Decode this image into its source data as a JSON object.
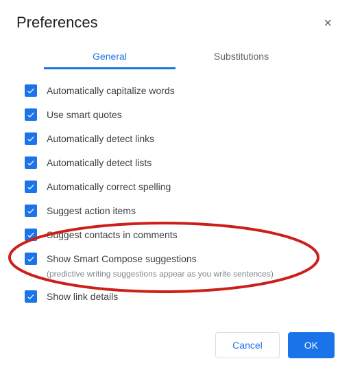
{
  "dialog": {
    "title": "Preferences",
    "tabs": [
      {
        "label": "General",
        "active": true
      },
      {
        "label": "Substitutions",
        "active": false
      }
    ],
    "options": [
      {
        "label": "Automatically capitalize words",
        "checked": true
      },
      {
        "label": "Use smart quotes",
        "checked": true
      },
      {
        "label": "Automatically detect links",
        "checked": true
      },
      {
        "label": "Automatically detect lists",
        "checked": true
      },
      {
        "label": "Automatically correct spelling",
        "checked": true
      },
      {
        "label": "Suggest action items",
        "checked": true
      },
      {
        "label": "Suggest contacts in comments",
        "checked": true
      },
      {
        "label": "Show Smart Compose suggestions",
        "checked": true,
        "description": "(predictive writing suggestions appear as you write sentences)"
      },
      {
        "label": "Show link details",
        "checked": true
      }
    ],
    "buttons": {
      "cancel": "Cancel",
      "ok": "OK"
    },
    "annotation": {
      "highlighted_option_label": "Show Smart Compose suggestions",
      "color": "#cc1f1a"
    }
  }
}
